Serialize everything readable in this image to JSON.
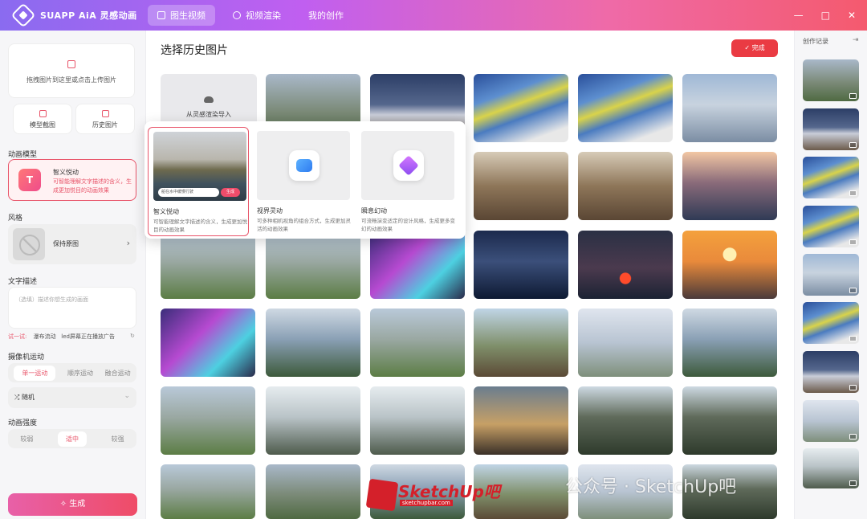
{
  "app": {
    "title": "SUAPP AiA 灵感动画"
  },
  "nav": {
    "tabs": [
      {
        "label": "图生视频"
      },
      {
        "label": "视频渲染"
      },
      {
        "label": "我的创作"
      }
    ]
  },
  "window": {
    "minimize": "—",
    "maximize": "□",
    "close": "✕"
  },
  "left": {
    "upload_text": "拖拽图片到这里或点击上传图片",
    "model_shot": "模型截图",
    "history_images": "历史图片",
    "anim_model_label": "动画模型",
    "model": {
      "icon_letter": "T",
      "name": "智义悦动",
      "desc": "可智能理解文字描述的含义，生成更加悦目的动画效果"
    },
    "style_label": "风格",
    "style_value": "保持原图",
    "text_desc_label": "文字描述",
    "text_placeholder": "（选填）描述你想生成的画面",
    "try": {
      "prefix": "试一试:",
      "items": [
        "瀑布流动",
        "led屏幕正在播放广告"
      ],
      "refresh": "↻"
    },
    "camera_label": "摄像机运动",
    "camera_options": [
      "单一运动",
      "顺序运动",
      "融合运动"
    ],
    "random_label": "随机",
    "intensity_label": "动画强度",
    "intensity_options": [
      "较弱",
      "适中",
      "较强"
    ],
    "generate": "生成"
  },
  "main": {
    "title": "选择历史图片",
    "done": "完成",
    "import_tile": "从灵感渲染导入"
  },
  "popover": {
    "options": [
      {
        "name": "智义悦动",
        "desc": "可智能理解文字描述的含义，生成更加悦目的动画效果",
        "prompt": "船在水中缓慢行驶",
        "prompt_btn": "生成"
      },
      {
        "name": "视界灵动",
        "desc": "可多种相机视角的组合方式，生成更加灵活的动画效果"
      },
      {
        "name": "瞬息幻动",
        "desc": "可流畅演变适定的设计风格，生成更多变幻的动画效果"
      }
    ]
  },
  "right": {
    "title": "创作记录",
    "collapse": "⇥"
  },
  "watermark": {
    "logo_text": "SketchUp吧",
    "site": "sketchupbar.com",
    "text": "公众号 · SketchUp吧"
  }
}
